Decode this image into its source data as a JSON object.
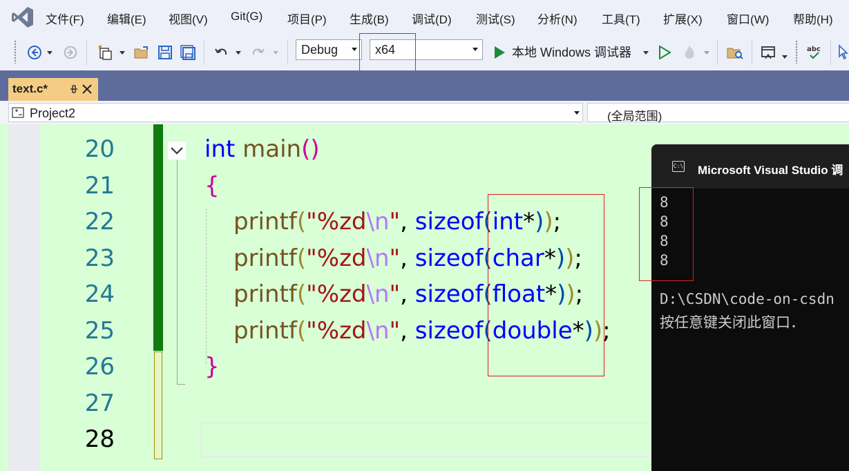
{
  "menu": [
    "文件(F)",
    "编辑(E)",
    "视图(V)",
    "Git(G)",
    "项目(P)",
    "生成(B)",
    "调试(D)",
    "测试(S)",
    "分析(N)",
    "工具(T)",
    "扩展(X)",
    "窗口(W)",
    "帮助(H)"
  ],
  "toolbar": {
    "configuration": "Debug",
    "platform": "x64",
    "debugger_label": "本地 Windows 调试器"
  },
  "tab": {
    "filename": "text.c*"
  },
  "navbar": {
    "project": "Project2",
    "scope": "(全局范围)"
  },
  "editor": {
    "line_numbers": [
      "20",
      "21",
      "22",
      "23",
      "24",
      "25",
      "26",
      "27",
      "28"
    ],
    "current_line": "28",
    "code": {
      "kw_int": "int",
      "fn_main": "main",
      "open_paren": "(",
      "close_paren": ")",
      "open_brace": "{",
      "close_brace": "}",
      "printf": "printf",
      "fmt_pre": "\"%zd",
      "escape": "\\n",
      "quote": "\"",
      "comma": ", ",
      "sizeof": "sizeof",
      "star": "*",
      "semicolon": ";",
      "types": [
        "int",
        "char",
        "float",
        "double"
      ]
    }
  },
  "console": {
    "title": "Microsoft Visual Studio 调",
    "icon_text": "C:\\",
    "outputs": [
      "8",
      "8",
      "8",
      "8"
    ],
    "path_line": "D:\\CSDN\\code-on-csdn",
    "prompt": "按任意键关闭此窗口．"
  },
  "colors": {
    "editor_bg": "#d8ffd6",
    "keyword": "#0000ff",
    "function": "#74531f",
    "string": "#a31515",
    "highlight_box": "#e02020",
    "tab_active": "#f5cc84",
    "console_bg": "#0c0c0c"
  }
}
